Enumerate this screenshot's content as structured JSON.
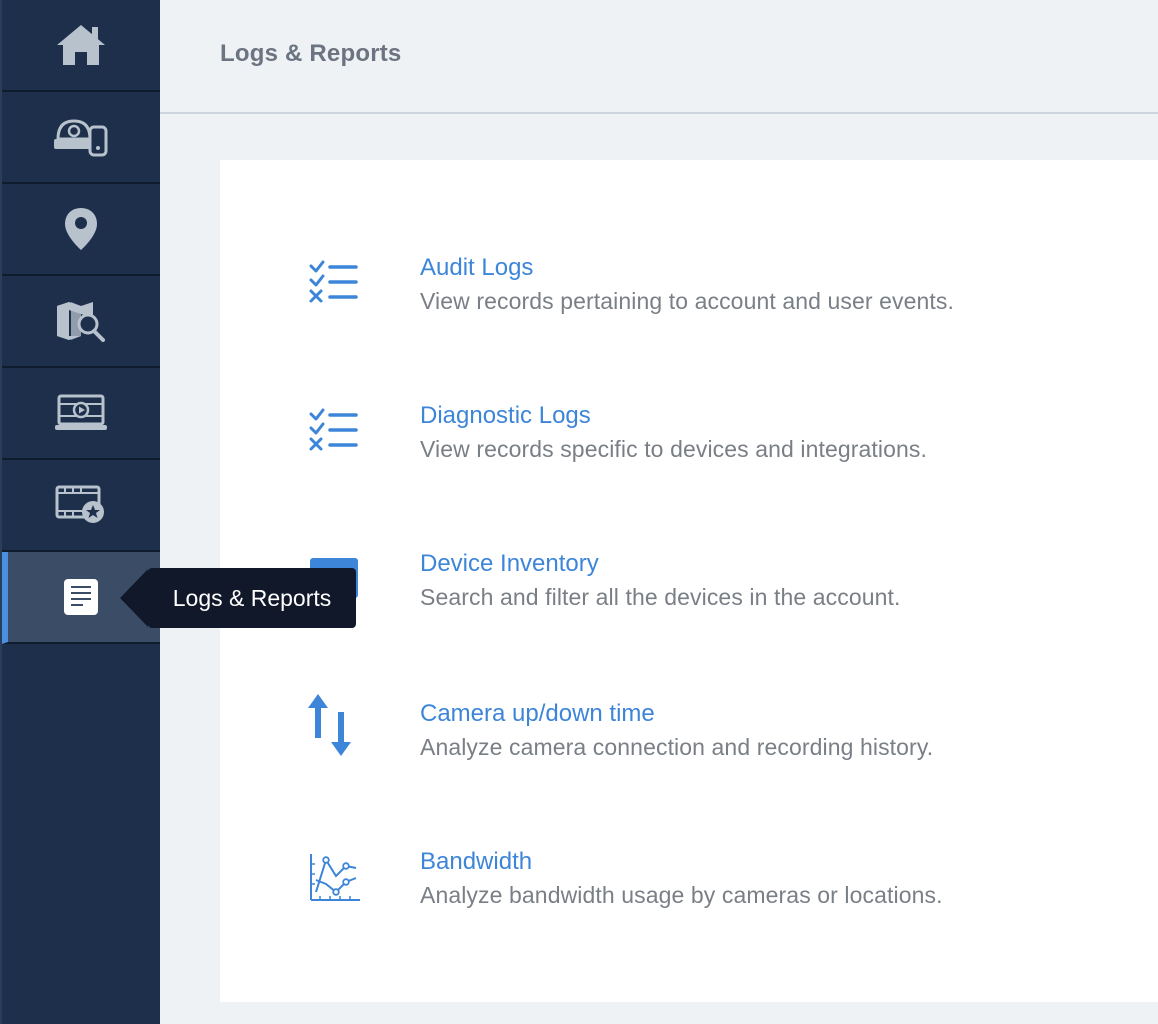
{
  "header": {
    "title": "Logs & Reports"
  },
  "sidebar": {
    "items": [
      {
        "name": "home",
        "icon": "home-icon"
      },
      {
        "name": "devices",
        "icon": "devices-icon"
      },
      {
        "name": "locations",
        "icon": "location-pin-icon"
      },
      {
        "name": "map-search",
        "icon": "map-search-icon"
      },
      {
        "name": "video-wall",
        "icon": "video-monitor-icon"
      },
      {
        "name": "saved-videos",
        "icon": "film-star-icon"
      },
      {
        "name": "logs-reports",
        "icon": "document-icon",
        "active": true
      }
    ],
    "tooltip": "Logs & Reports"
  },
  "reports": [
    {
      "title": "Audit Logs",
      "description": "View records pertaining to account and user events.",
      "icon": "checklist-icon"
    },
    {
      "title": "Diagnostic Logs",
      "description": "View records specific to devices and integrations.",
      "icon": "checklist-icon"
    },
    {
      "title": "Device Inventory",
      "description": "Search and filter all the devices in the account.",
      "icon": "inventory-icon"
    },
    {
      "title": "Camera up/down time",
      "description": "Analyze camera connection and recording history.",
      "icon": "up-down-arrows-icon"
    },
    {
      "title": "Bandwidth",
      "description": "Analyze bandwidth usage by cameras or locations.",
      "icon": "line-chart-icon"
    }
  ],
  "colors": {
    "sidebar": "#1d2f4a",
    "accent": "#3d85d8",
    "active": "#4a8fe0",
    "icon": "#b8c2cd"
  }
}
